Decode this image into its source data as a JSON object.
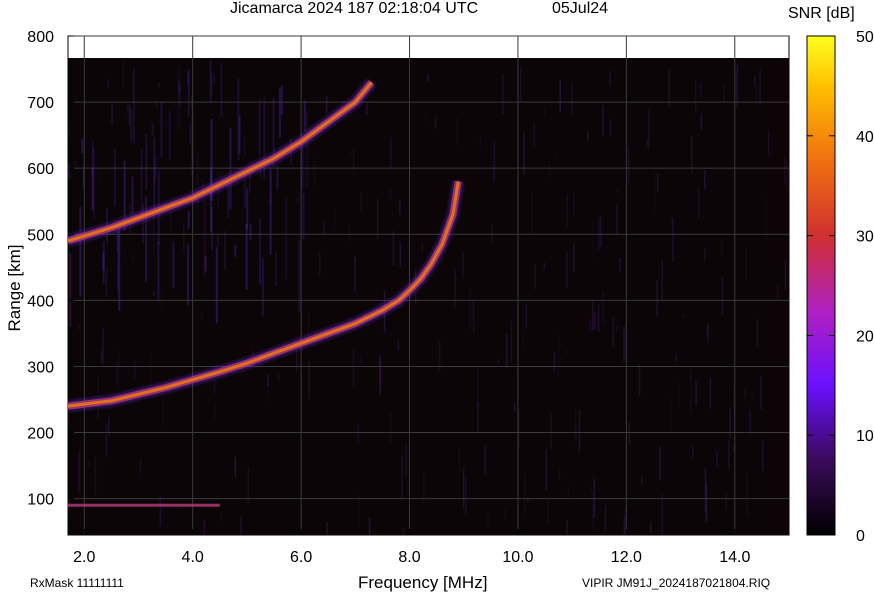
{
  "header": {
    "title": "Jicamarca 2024 187 02:18:04 UTC",
    "date": "05Jul24"
  },
  "colorbar": {
    "label": "SNR [dB]",
    "ticks": [
      "50",
      "40",
      "30",
      "20",
      "10",
      "0"
    ],
    "range": [
      0,
      50
    ]
  },
  "footer": {
    "left": "RxMask 11111111",
    "right": "VIPIR  JM91J_2024187021804.RIQ"
  },
  "colors": {
    "background": "#0b0508",
    "trace_core": "#e0701a",
    "trace_edge": "#b83a7a",
    "noise": "#6a2fd6",
    "grid": "#3a3a3a"
  },
  "chart_data": {
    "type": "heatmap",
    "title": "Jicamarca 2024 187 02:18:04 UTC",
    "xlabel": "Frequency [MHz]",
    "ylabel": "Range [km]",
    "xlim": [
      1.7,
      15.0
    ],
    "ylim": [
      45,
      800
    ],
    "x_ticks": [
      "2.0",
      "4.0",
      "6.0",
      "8.0",
      "10.0",
      "12.0",
      "14.0"
    ],
    "x_tick_values": [
      2.0,
      4.0,
      6.0,
      8.0,
      10.0,
      12.0,
      14.0
    ],
    "y_ticks": [
      "800",
      "700",
      "600",
      "500",
      "400",
      "300",
      "200",
      "100"
    ],
    "y_tick_values": [
      800,
      700,
      600,
      500,
      400,
      300,
      200,
      100
    ],
    "colorbar_label": "SNR [dB]",
    "colorbar_range": [
      0,
      50
    ],
    "grid": true,
    "traces": [
      {
        "name": "",
        "x": [
          1.7,
          2.5,
          3.0,
          3.5,
          4.0,
          4.5,
          5.0,
          5.5,
          6.0,
          6.5,
          7.0,
          7.5,
          7.8,
          8.0,
          8.2,
          8.4,
          8.6,
          8.8,
          8.9
        ],
        "y": [
          240,
          248,
          258,
          268,
          280,
          292,
          305,
          320,
          335,
          350,
          365,
          385,
          400,
          415,
          432,
          455,
          485,
          530,
          580
        ],
        "snr": [
          30,
          32,
          30,
          31,
          30,
          28,
          30,
          30,
          32,
          35,
          36,
          35,
          34,
          33,
          30,
          26,
          22,
          18,
          14
        ]
      },
      {
        "name": "",
        "x": [
          1.7,
          2.5,
          3.0,
          3.5,
          4.0,
          4.5,
          5.0,
          5.5,
          6.0,
          6.5,
          7.0,
          7.3
        ],
        "y": [
          490,
          510,
          525,
          540,
          555,
          575,
          595,
          615,
          640,
          670,
          700,
          730
        ],
        "snr": [
          18,
          25,
          30,
          32,
          30,
          28,
          28,
          26,
          24,
          26,
          28,
          22
        ]
      },
      {
        "name": "",
        "x": [
          1.7,
          2.5,
          3.0,
          3.5,
          4.0,
          4.5
        ],
        "y": [
          90,
          90,
          90,
          90,
          90,
          90
        ],
        "snr": [
          14,
          12,
          10,
          9,
          8,
          7
        ]
      }
    ]
  }
}
